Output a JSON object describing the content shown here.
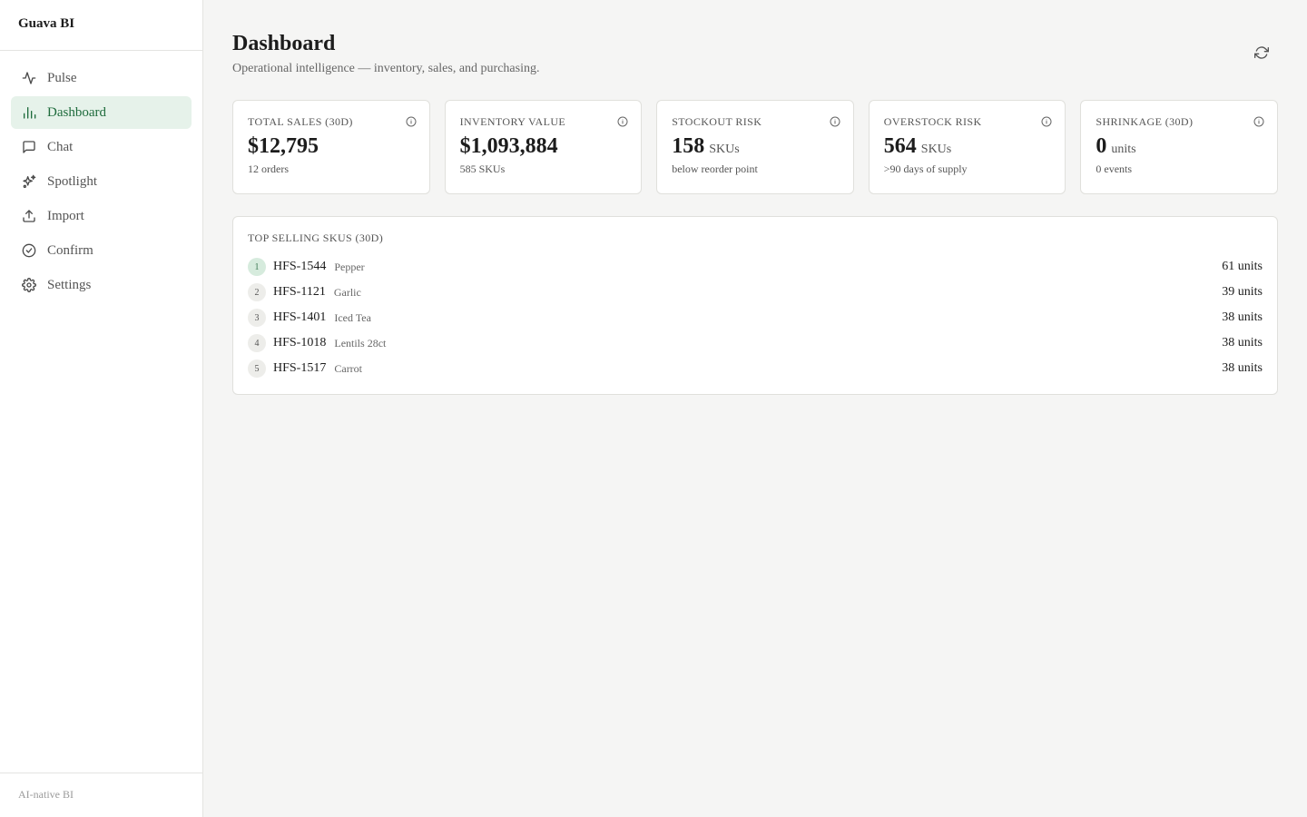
{
  "sidebar": {
    "brand": "Guava BI",
    "items": [
      {
        "label": "Pulse",
        "icon": "pulse-icon",
        "active": false
      },
      {
        "label": "Dashboard",
        "icon": "bar-chart-icon",
        "active": true
      },
      {
        "label": "Chat",
        "icon": "chat-icon",
        "active": false
      },
      {
        "label": "Spotlight",
        "icon": "sparkles-icon",
        "active": false
      },
      {
        "label": "Import",
        "icon": "upload-icon",
        "active": false
      },
      {
        "label": "Confirm",
        "icon": "check-circle-icon",
        "active": false
      },
      {
        "label": "Settings",
        "icon": "gear-icon",
        "active": false
      }
    ],
    "footer": "AI-native BI"
  },
  "header": {
    "title": "Dashboard",
    "subtitle": "Operational intelligence — inventory, sales, and purchasing."
  },
  "kpis": [
    {
      "label": "TOTAL SALES (30D)",
      "value": "$12,795",
      "unit": "",
      "sub": "12 orders"
    },
    {
      "label": "INVENTORY VALUE",
      "value": "$1,093,884",
      "unit": "",
      "sub": "585 SKUs"
    },
    {
      "label": "STOCKOUT RISK",
      "value": "158",
      "unit": "SKUs",
      "sub": "below reorder point"
    },
    {
      "label": "OVERSTOCK RISK",
      "value": "564",
      "unit": "SKUs",
      "sub": ">90 days of supply"
    },
    {
      "label": "SHRINKAGE (30D)",
      "value": "0",
      "unit": "units",
      "sub": "0 events"
    }
  ],
  "top_skus": {
    "title": "TOP SELLING SKUS (30D)",
    "rows": [
      {
        "rank": "1",
        "code": "HFS-1544",
        "name": "Pepper",
        "units": "61 units"
      },
      {
        "rank": "2",
        "code": "HFS-1121",
        "name": "Garlic",
        "units": "39 units"
      },
      {
        "rank": "3",
        "code": "HFS-1401",
        "name": "Iced Tea",
        "units": "38 units"
      },
      {
        "rank": "4",
        "code": "HFS-1018",
        "name": "Lentils 28ct",
        "units": "38 units"
      },
      {
        "rank": "5",
        "code": "HFS-1517",
        "name": "Carrot",
        "units": "38 units"
      }
    ]
  },
  "colors": {
    "accent": "#1e6b3c",
    "accent_bg": "#e6f2ea",
    "page_bg": "#f5f5f4"
  }
}
